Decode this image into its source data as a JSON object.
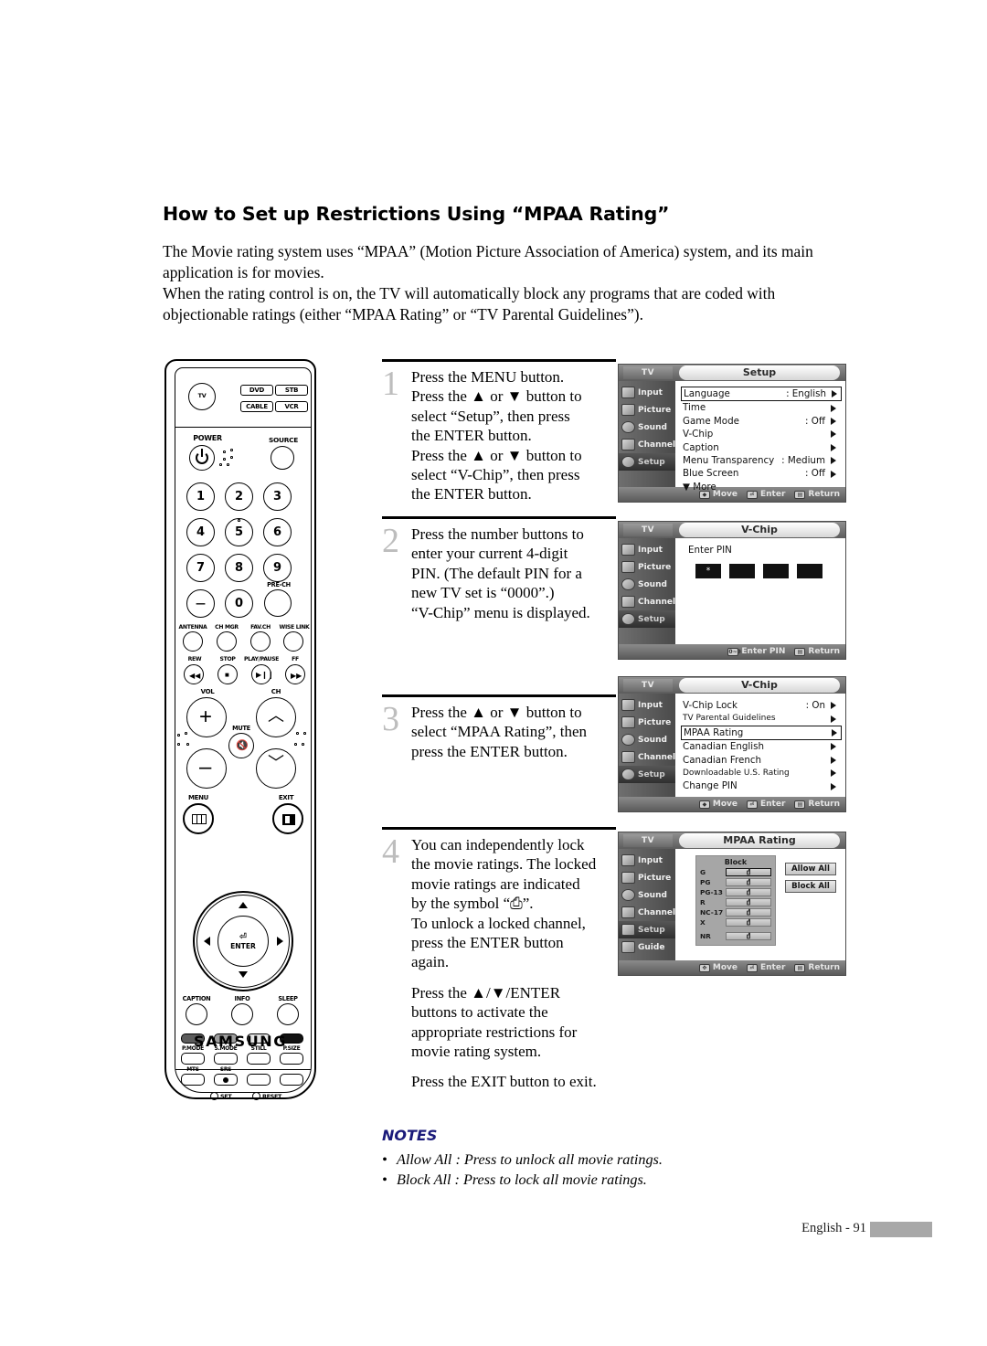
{
  "page": {
    "heading": "How to Set up Restrictions Using “MPAA Rating”",
    "intro_p1": "The Movie rating system uses “MPAA” (Motion Picture Association of America) system, and its main application is for movies.",
    "intro_p2": "When the rating control is on, the TV will automatically block any programs that are coded with objectionable ratings (either “MPAA Rating” or “TV Parental Guidelines”).",
    "footer_text": "English - 91"
  },
  "remote": {
    "brand": "SAMSUNG",
    "mode_tv": "TV",
    "mode_dvd": "DVD",
    "mode_stb": "STB",
    "mode_cable": "CABLE",
    "mode_vcr": "VCR",
    "power": "POWER",
    "source": "SOURCE",
    "keys": [
      "1",
      "2",
      "3",
      "4",
      "5",
      "6",
      "7",
      "8",
      "9",
      "—",
      "0"
    ],
    "pre_ch": "PRE-CH",
    "antenna": "ANTENNA",
    "ch_mgr": "CH MGR",
    "fav_ch": "FAV.CH",
    "wise_link": "WISE LINK",
    "rew": "REW",
    "stop": "STOP",
    "play_pause": "PLAY/PAUSE",
    "ff": "FF",
    "vol": "VOL",
    "ch": "CH",
    "mute": "MUTE",
    "menu": "MENU",
    "exit": "EXIT",
    "enter": "ENTER",
    "caption": "CAPTION",
    "info": "INFO",
    "sleep": "SLEEP",
    "p_mode": "P.MODE",
    "s_mode": "S.MODE",
    "still": "STILL",
    "p_size": "P.SIZE",
    "mts": "MTS",
    "srs": "SRS",
    "set": "SET",
    "reset": "RESET"
  },
  "steps": [
    {
      "number": "1",
      "lines": [
        "Press the MENU button.",
        "Press the ▲ or ▼ button to",
        "select “Setup”, then press",
        "the ENTER button.",
        "Press the ▲ or ▼ button to",
        "select “V-Chip”, then press",
        "the ENTER button."
      ]
    },
    {
      "number": "2",
      "lines": [
        "Press the number buttons to",
        "enter your current 4-digit",
        "PIN. (The default PIN for a",
        "new TV set is “0000”.)",
        "“V-Chip” menu is displayed."
      ]
    },
    {
      "number": "3",
      "lines": [
        "Press the ▲ or ▼ button to",
        "select “MPAA Rating”, then",
        "press the ENTER button."
      ]
    },
    {
      "number": "4",
      "lines": [
        "You can independently lock",
        "the movie ratings. The locked",
        "movie ratings are indicated",
        "by the symbol “⎙”.",
        "To unlock a locked channel,",
        "press the ENTER button",
        "again.",
        "",
        "Press the ▲/▼/ENTER",
        "buttons to activate the",
        "appropriate restrictions for",
        "movie rating system.",
        "",
        "Press the EXIT button to exit."
      ]
    }
  ],
  "osd_panels": [
    {
      "tv_label": "TV",
      "title": "Setup",
      "sidebar": [
        "Input",
        "Picture",
        "Sound",
        "Channel",
        "Setup"
      ],
      "sidebar_active": "Setup",
      "rows": [
        {
          "label": "Language",
          "value": ": English",
          "selected": true,
          "arrow": true
        },
        {
          "label": "Time",
          "value": "",
          "selected": false,
          "arrow": true
        },
        {
          "label": "Game Mode",
          "value": ": Off",
          "selected": false,
          "arrow": true
        },
        {
          "label": "V-Chip",
          "value": "",
          "selected": false,
          "arrow": true
        },
        {
          "label": "Caption",
          "value": "",
          "selected": false,
          "arrow": true
        },
        {
          "label": "Menu Transparency",
          "value": ": Medium",
          "selected": false,
          "arrow": true
        },
        {
          "label": "Blue Screen",
          "value": ": Off",
          "selected": false,
          "arrow": true
        },
        {
          "label": "▼ More",
          "value": "",
          "selected": false,
          "arrow": false
        }
      ],
      "footer": [
        {
          "icon": "move",
          "label": "Move"
        },
        {
          "icon": "enter",
          "label": "Enter"
        },
        {
          "icon": "return",
          "label": "Return"
        }
      ]
    },
    {
      "tv_label": "TV",
      "title": "V-Chip",
      "sidebar": [
        "Input",
        "Picture",
        "Sound",
        "Channel",
        "Setup"
      ],
      "sidebar_active": "Setup",
      "pin_prompt": "Enter PIN",
      "pin_boxes": [
        "*",
        "",
        "",
        ""
      ],
      "footer": [
        {
          "icon": "digits",
          "label": "Enter PIN"
        },
        {
          "icon": "return",
          "label": "Return"
        }
      ]
    },
    {
      "tv_label": "TV",
      "title": "V-Chip",
      "sidebar": [
        "Input",
        "Picture",
        "Sound",
        "Channel",
        "Setup"
      ],
      "sidebar_active": "Setup",
      "rows": [
        {
          "label": "V-Chip Lock",
          "value": ": On",
          "selected": false,
          "arrow": true
        },
        {
          "label": "TV Parental Guidelines",
          "value": "",
          "selected": false,
          "arrow": true,
          "small": true
        },
        {
          "label": "MPAA Rating",
          "value": "",
          "selected": true,
          "arrow": true
        },
        {
          "label": "Canadian English",
          "value": "",
          "selected": false,
          "arrow": true
        },
        {
          "label": "Canadian French",
          "value": "",
          "selected": false,
          "arrow": true
        },
        {
          "label": "Downloadable U.S. Rating",
          "value": "",
          "selected": false,
          "arrow": true,
          "small": true
        },
        {
          "label": "Change PIN",
          "value": "",
          "selected": false,
          "arrow": true
        }
      ],
      "footer": [
        {
          "icon": "move",
          "label": "Move"
        },
        {
          "icon": "enter",
          "label": "Enter"
        },
        {
          "icon": "return",
          "label": "Return"
        }
      ]
    },
    {
      "tv_label": "TV",
      "title": "MPAA Rating",
      "sidebar": [
        "Input",
        "Picture",
        "Sound",
        "Channel",
        "Setup",
        "Guide"
      ],
      "sidebar_active": "Setup",
      "block_header": "Block",
      "ratings": [
        {
          "name": "G",
          "selected": true
        },
        {
          "name": "PG",
          "selected": false
        },
        {
          "name": "PG-13",
          "selected": false
        },
        {
          "name": "R",
          "selected": false
        },
        {
          "name": "NC-17",
          "selected": false
        },
        {
          "name": "X",
          "selected": false
        }
      ],
      "ratings_extra": [
        {
          "name": "NR",
          "selected": false
        }
      ],
      "buttons": [
        "Allow All",
        "Block All"
      ],
      "footer": [
        {
          "icon": "move",
          "label": "Move"
        },
        {
          "icon": "enter",
          "label": "Enter"
        },
        {
          "icon": "return",
          "label": "Return"
        }
      ]
    }
  ],
  "notes": {
    "title": "NOTES",
    "items": [
      "Allow All : Press to unlock all movie ratings.",
      "Block All : Press to lock all movie ratings."
    ]
  }
}
